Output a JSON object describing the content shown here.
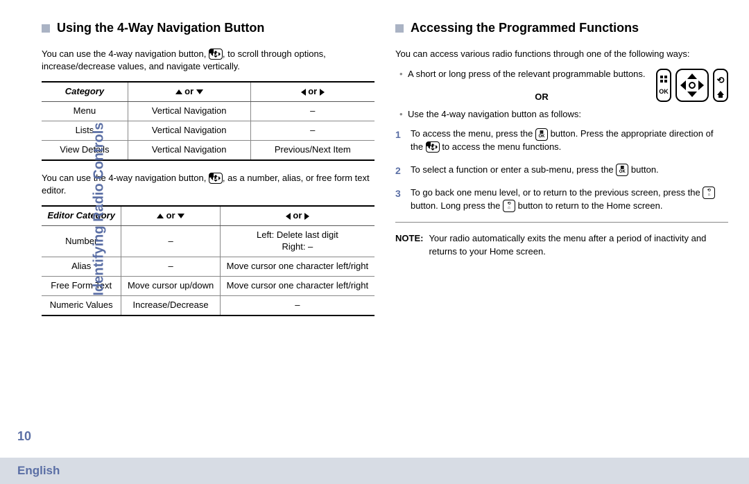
{
  "side_label": "Identifying Radio Controls",
  "page_number": "10",
  "footer_language": "English",
  "left": {
    "title": "Using the 4-Way Navigation Button",
    "intro": "You can use the 4-way navigation button, ",
    "intro_tail": ", to scroll through options, increase/decrease values, and navigate vertically.",
    "table1": {
      "h1": "Category",
      "h2": " or ",
      "h3": " or ",
      "rows": [
        {
          "c1": "Menu",
          "c2": "Vertical Navigation",
          "c3": "–"
        },
        {
          "c1": "Lists",
          "c2": "Vertical Navigation",
          "c3": "–"
        },
        {
          "c1": "View Details",
          "c2": "Vertical Navigation",
          "c3": "Previous/Next Item"
        }
      ]
    },
    "mid": "You can use the 4-way navigation button, ",
    "mid_tail": ", as a number, alias, or free form text editor.",
    "table2": {
      "h1": "Editor Category",
      "h2": " or ",
      "h3": " or ",
      "rows": [
        {
          "c1": "Number",
          "c2": "–",
          "c3": "Left: Delete last digit\nRight: –"
        },
        {
          "c1": "Alias",
          "c2": "–",
          "c3": "Move cursor one character left/right"
        },
        {
          "c1": "Free Form Text",
          "c2": "Move cursor up/down",
          "c3": "Move cursor one character left/right"
        },
        {
          "c1": "Numeric Values",
          "c2": "Increase/Decrease",
          "c3": "–"
        }
      ]
    }
  },
  "right": {
    "title": "Accessing the Programmed Functions",
    "intro": "You can access various radio functions through one of the following ways:",
    "bullet1": "A short or long press of the relevant programmable buttons.",
    "or_label": "OR",
    "left_btn_label": "OK",
    "bullet2": "Use the 4-way navigation button as follows:",
    "steps": [
      {
        "pre": "To access the menu, press the ",
        "mid": " button. Press the appropriate direction of the ",
        "post": " to access the menu functions."
      },
      {
        "pre": "To select a function or enter a sub-menu, press the ",
        "post": " button."
      },
      {
        "pre": "To go back one menu level, or to return to the previous screen, press the ",
        "mid": " button. Long press the ",
        "post": " button to return to the Home screen."
      }
    ],
    "note_label": "NOTE:",
    "note_text": "Your radio automatically exits the menu after a period of inactivity and returns to your Home screen."
  }
}
